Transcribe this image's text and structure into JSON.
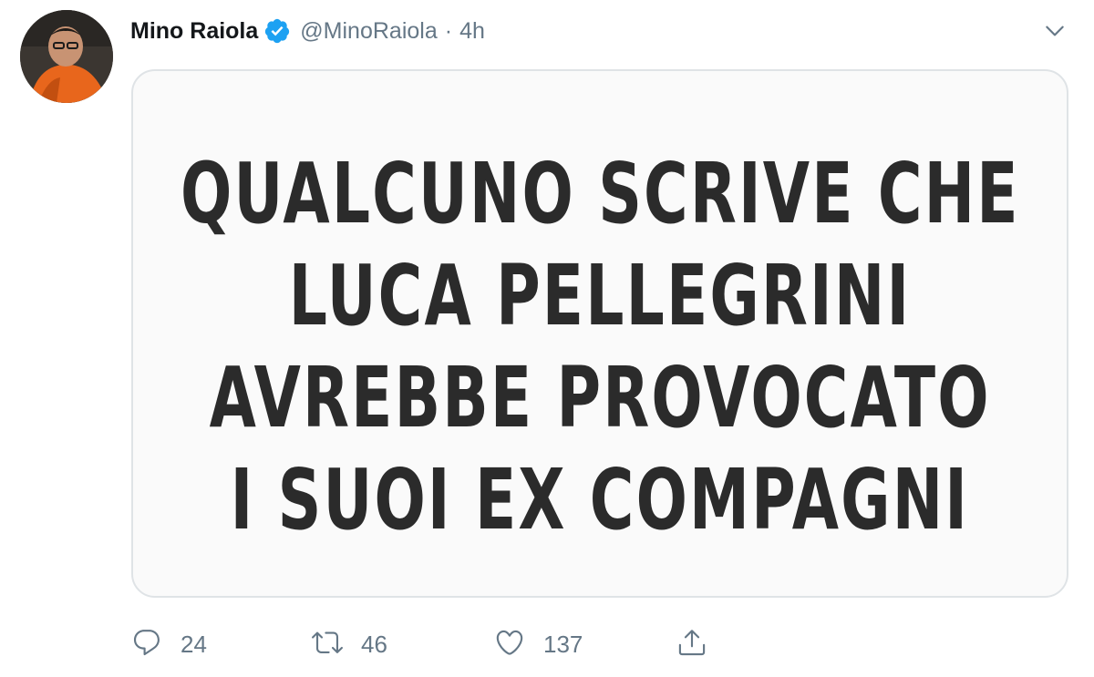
{
  "author": {
    "display_name": "Mino Raiola",
    "handle": "@MinoRaiola",
    "separator": "·",
    "time": "4h",
    "verified": true,
    "avatar_icon": "profile-photo"
  },
  "media": {
    "lines": [
      "QUALCUNO SCRIVE CHE",
      "LUCA PELLEGRINI",
      "AVREBBE PROVOCATO",
      "I SUOI EX COMPAGNI"
    ]
  },
  "actions": {
    "reply_count": "24",
    "retweet_count": "46",
    "like_count": "137"
  },
  "colors": {
    "verified_badge": "#1da1f2",
    "secondary_text": "#657786",
    "image_text": "#2b2b2b"
  }
}
